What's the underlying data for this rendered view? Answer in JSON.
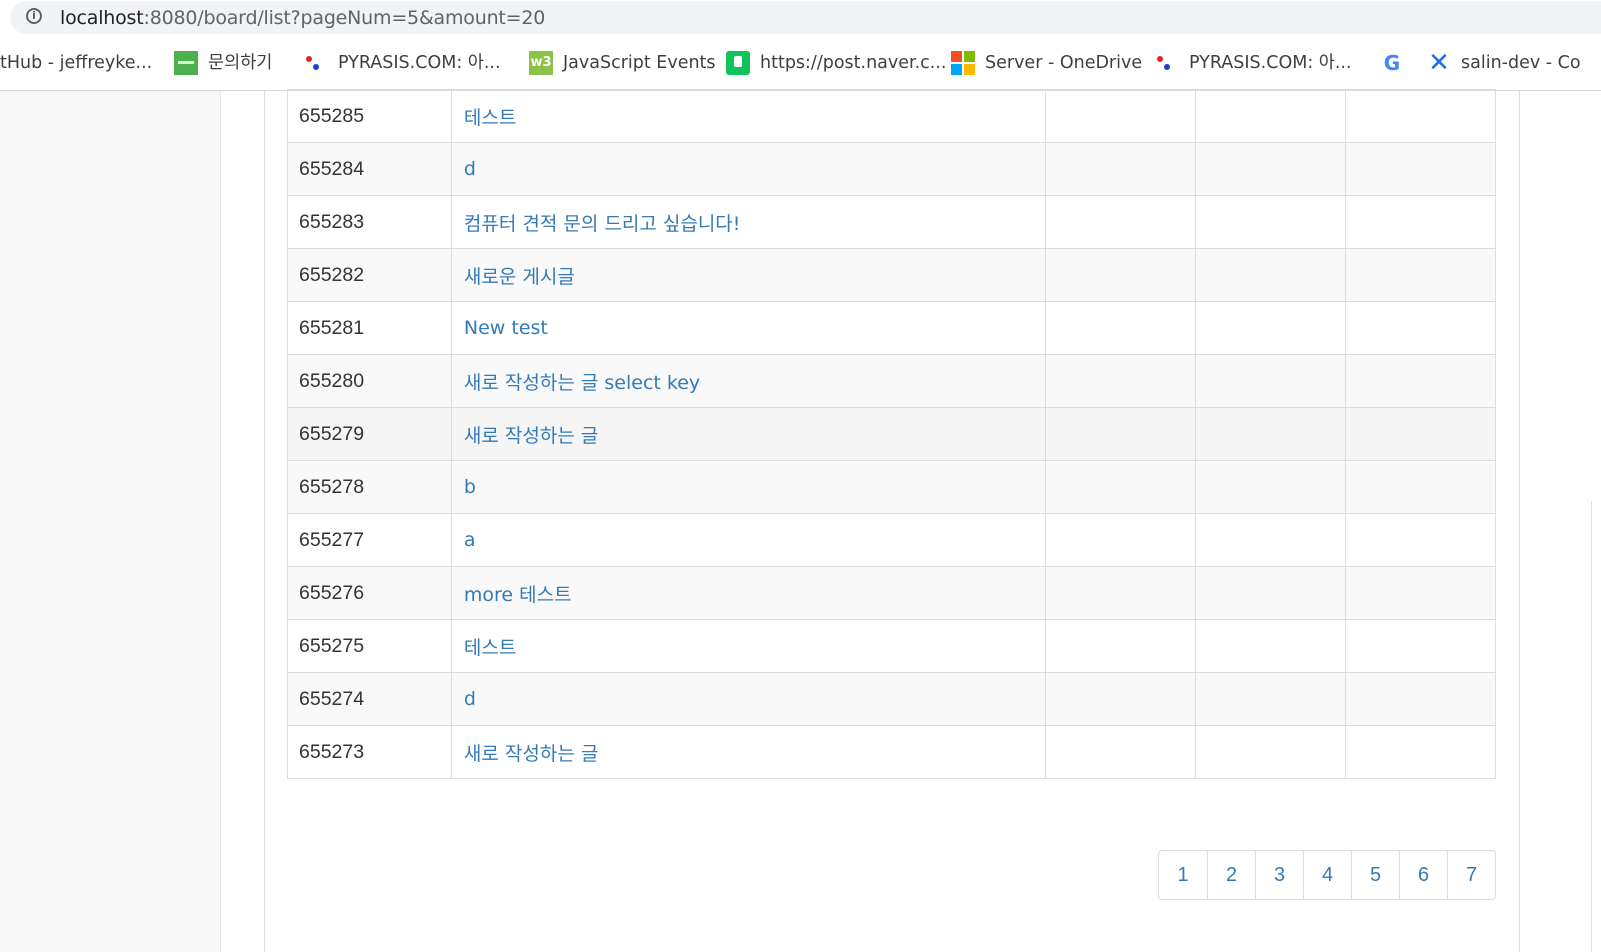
{
  "browser": {
    "url_host": "localhost",
    "url_rest": ":8080/board/list?pageNum=5&amount=20",
    "bookmarks": [
      {
        "label": "tHub - jeffreyke...",
        "icon": "none"
      },
      {
        "label": "문의하기",
        "icon": "green-site-icon"
      },
      {
        "label": "PYRASIS.COM: 아...",
        "icon": "pyrasis-icon"
      },
      {
        "label": "JavaScript Events",
        "icon": "w3schools-icon"
      },
      {
        "label": "https://post.naver.c...",
        "icon": "naver-post-icon"
      },
      {
        "label": "Server - OneDrive",
        "icon": "microsoft-icon"
      },
      {
        "label": "PYRASIS.COM: 아...",
        "icon": "pyrasis-icon"
      },
      {
        "label": "",
        "icon": "google-icon"
      },
      {
        "label": "salin-dev - Co",
        "icon": "confluence-icon"
      }
    ]
  },
  "board": {
    "rows": [
      {
        "bno": "655285",
        "title": "테스트"
      },
      {
        "bno": "655284",
        "title": "d"
      },
      {
        "bno": "655283",
        "title": "컴퓨터 견적 문의 드리고 싶습니다!"
      },
      {
        "bno": "655282",
        "title": "새로운 게시글"
      },
      {
        "bno": "655281",
        "title": "New test"
      },
      {
        "bno": "655280",
        "title": "새로 작성하는 글 select key"
      },
      {
        "bno": "655279",
        "title": "새로 작성하는 글"
      },
      {
        "bno": "655278",
        "title": "b"
      },
      {
        "bno": "655277",
        "title": "a"
      },
      {
        "bno": "655276",
        "title": "more 테스트"
      },
      {
        "bno": "655275",
        "title": "테스트"
      },
      {
        "bno": "655274",
        "title": "d"
      },
      {
        "bno": "655273",
        "title": "새로 작성하는 글"
      }
    ]
  },
  "pagination": {
    "pages": [
      "1",
      "2",
      "3",
      "4",
      "5",
      "6",
      "7"
    ]
  },
  "colors": {
    "link": "#337ab7",
    "border": "#dddddd",
    "stripe": "#f9f9f9"
  }
}
